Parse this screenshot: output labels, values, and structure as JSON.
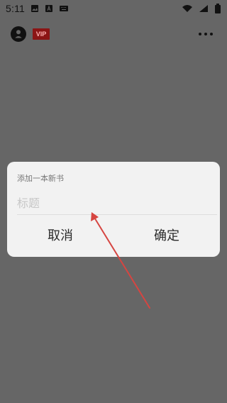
{
  "status_bar": {
    "time": "5:11",
    "left_icons": [
      "image-icon",
      "text-icon",
      "keyboard-icon"
    ],
    "right_icons": [
      "wifi-icon",
      "signal-icon",
      "battery-icon"
    ]
  },
  "header": {
    "avatar_icon": "user-avatar-icon",
    "vip_label": "VIP",
    "more_icon": "more-horizontal-icon"
  },
  "dialog": {
    "title": "添加一本新书",
    "title_field_placeholder": "标题",
    "cancel_label": "取消",
    "confirm_label": "确定"
  },
  "colors": {
    "background": "#666666",
    "dialog": "#f2f2f2",
    "vip_badge": "#8b1515",
    "annotation_arrow": "#d64541"
  }
}
